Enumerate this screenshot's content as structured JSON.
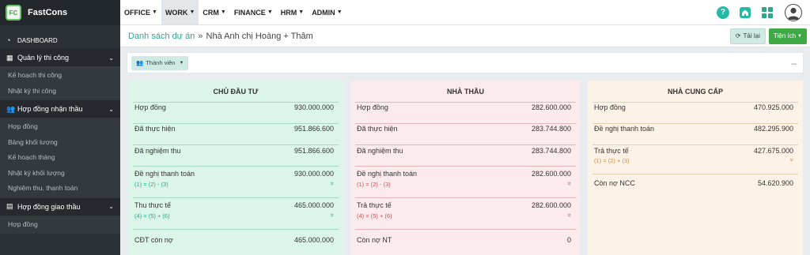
{
  "brand": {
    "logo_text": "FC",
    "name": "FastCons"
  },
  "sidebar": {
    "dashboard": "DASHBOARD",
    "sections": [
      {
        "label": "Quản lý thi công",
        "items": [
          "Kế hoạch thi công",
          "Nhật ký thi công"
        ]
      },
      {
        "label": "Hợp đồng nhận thầu",
        "items": [
          "Hợp đồng",
          "Bảng khối lượng",
          "Kế hoạch tháng",
          "Nhật ký khối lượng",
          "Nghiệm thu, thanh toán"
        ]
      },
      {
        "label": "Hợp đồng giao thầu",
        "items": [
          "Hợp đồng"
        ]
      }
    ]
  },
  "topmenu": [
    "OFFICE",
    "WORK",
    "CRM",
    "FINANCE",
    "HRM",
    "ADMIN"
  ],
  "topmenu_active": "WORK",
  "breadcrumb": {
    "root": "Danh sách dự án",
    "separator": "»",
    "current": "Nhà Anh chị Hoàng + Thâm"
  },
  "actions": {
    "reload": "Tải lại",
    "utilities": "Tiện ích"
  },
  "filter": {
    "member_button": "Thành viên"
  },
  "colors": {
    "accent": "#2ba89a",
    "success": "#3fa945",
    "green_panel": "#dcf5ea",
    "pink_panel": "#fcebec",
    "orange_panel": "#fdf2e6"
  },
  "panels": {
    "owner": {
      "title": "CHỦ ĐẦU TƯ",
      "rows": [
        {
          "label": "Hợp đồng",
          "value": "930.000.000"
        },
        {
          "label": "Đã thực hiện",
          "value": "951.866.600"
        },
        {
          "label": "Đã nghiệm thu",
          "value": "951.866.600"
        },
        {
          "label": "Đề nghị thanh toán",
          "value": "930.000.000",
          "formula": "(1) = (2) - (3)"
        },
        {
          "label": "Thu thực tế",
          "value": "465.000.000",
          "formula": "(4) = (5) + (6)"
        },
        {
          "label": "CĐT còn nợ",
          "value": "465.000.000"
        }
      ]
    },
    "contractor": {
      "title": "NHÀ THẦU",
      "rows": [
        {
          "label": "Hợp đồng",
          "value": "282.600.000"
        },
        {
          "label": "Đã thực hiện",
          "value": "283.744.800"
        },
        {
          "label": "Đã nghiệm thu",
          "value": "283.744.800"
        },
        {
          "label": "Đề nghị thanh toán",
          "value": "282.600.000",
          "formula": "(1) = (2) - (3)"
        },
        {
          "label": "Trả thực tế",
          "value": "282.600.000",
          "formula": "(4) = (5) + (6)"
        },
        {
          "label": "Còn nợ NT",
          "value": "0"
        }
      ]
    },
    "supplier": {
      "title": "NHÀ CUNG CẤP",
      "rows": [
        {
          "label": "Hợp đồng",
          "value": "470.925.000"
        },
        {
          "label": "Đề nghị thanh toán",
          "value": "482.295.900"
        },
        {
          "label": "Trả thực tế",
          "value": "427.675.000",
          "formula": "(1) = (2) + (3)"
        },
        {
          "label": "Còn nợ NCC",
          "value": "54.620.900"
        }
      ]
    }
  }
}
